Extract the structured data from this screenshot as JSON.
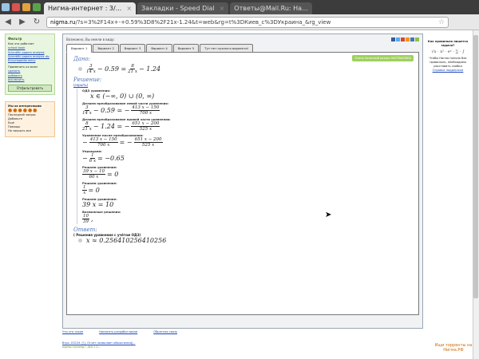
{
  "browser": {
    "tabs": [
      {
        "label": "Нигма-интернет : 3/...",
        "active": true
      },
      {
        "label": "Закладки - Speed Dial",
        "active": false
      },
      {
        "label": "Ответы@Mail.Ru: На...",
        "active": false
      }
    ],
    "url_host": "nigma.ru",
    "url_path": "/?s=3%2F14x+-+0.59%3D8%2F21x-1.24&t=web&rg=t%3DКиев_c%3DУкраина_&rg_view"
  },
  "left": {
    "filter_title": "Фильтр",
    "filter_subtitle": "Как это работает",
    "filter_items": [
      "school book",
      "Scientific papers analysis",
      "Scientific papers analysis dic",
      "Encyclopedia entry"
    ],
    "apply_label": "Применить ко всем",
    "apply_items": [
      "сделать",
      "добавить",
      "исключить"
    ],
    "filter_button": "Отфильтровать",
    "interest_title": "Мы из интересными",
    "interest_links": [
      "Последний запрос",
      "Добавьте",
      "Ещё",
      "Помощь",
      "Но закрыть все"
    ]
  },
  "main": {
    "top_text": "Возможно, Вы имели в виду:",
    "variant_tabs": [
      "Вариант 1",
      "Вариант 2",
      "Вариант 3",
      "Вариант 4",
      "Вариант 5",
      "Тут нет нужного варианта!"
    ],
    "badge": "Очень полезный раздел МАТЕМАТИКА",
    "given_title": "Дано:",
    "solution_title": "Решение:",
    "hide_link": "(скрыть)",
    "steps": [
      {
        "label": "ОДЗ уравнения:"
      },
      {
        "label": "Делаем преобразование левой части уравнения:"
      },
      {
        "label": "Делаем преобразование правой части уравнения:"
      },
      {
        "label": "Уравнение после преобразования:"
      },
      {
        "label": "Упрощаем:"
      },
      {
        "label": "Решаем уравнение:"
      },
      {
        "label": "Решаем уравнение:"
      },
      {
        "label": "Решаем уравнение:"
      },
      {
        "label": "Возможные решения:"
      }
    ],
    "answer_title": "Ответ:",
    "answer_note": "( Решения уравнения с учётом ОДЗ)",
    "answer_value": "x ≈ 0.256410256410256"
  },
  "right": {
    "question": "Как правильно пишется задача?",
    "help_text": "Чтобы Нигма поняла Вас правильно, необходимо расставить скобки",
    "help_link": "Справка поддержки"
  },
  "footer": {
    "links": [
      "Что это такое",
      "Написать разработчикам",
      "Обратная связь"
    ],
    "result_title": "Втрс. Ю21Н. [!]. Отчёт позволяет объяснения]...",
    "result_url": "nigma.ru/comp/.../bit-1.1..."
  },
  "logo": "Ищи торренты на Нигма.РФ"
}
